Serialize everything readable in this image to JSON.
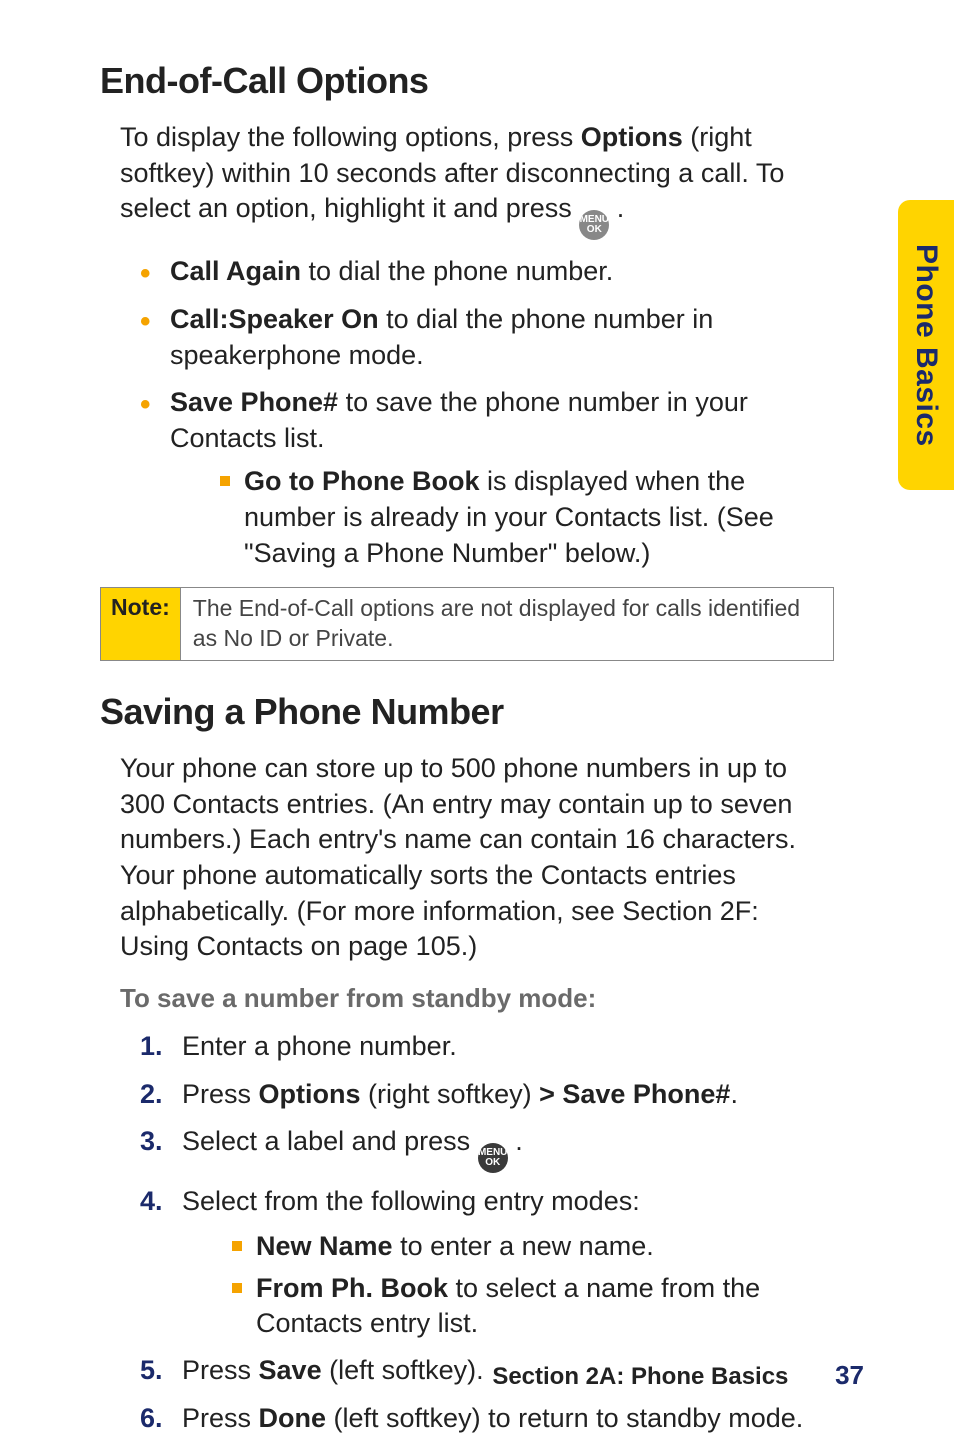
{
  "sideTab": "Phone Basics",
  "menuIconText": "MENU\nOK",
  "section1": {
    "title": "End-of-Call Options",
    "intro_part1": "To display the following options, press ",
    "intro_bold1": "Options",
    "intro_part2": " (right softkey) within 10 seconds after disconnecting a call. To select an option, highlight it and press ",
    "intro_part3": " .",
    "bullets": [
      {
        "bold": "Call Again",
        "rest": " to dial the phone number."
      },
      {
        "bold": "Call:Speaker On",
        "rest": " to dial the phone number in speakerphone mode."
      },
      {
        "bold": "Save Phone#",
        "rest": " to save the phone number in your Contacts list."
      }
    ],
    "sub": [
      {
        "bold": "Go to Phone Book",
        "rest": " is displayed when the number is already in your Contacts list. (See \"Saving a Phone Number\" below.)"
      }
    ],
    "noteLabel": "Note:",
    "noteText": "The End-of-Call options are not displayed for calls identified as No ID or Private."
  },
  "section2": {
    "title": "Saving a Phone Number",
    "intro": "Your phone can store up to 500 phone numbers in up to 300 Contacts entries. (An entry may contain up to seven numbers.) Each entry's name can contain 16 characters. Your phone automatically sorts the Contacts entries alphabetically. (For more information, see Section 2F: Using Contacts on page 105.)",
    "subhead": "To save a number from standby mode:",
    "steps": {
      "s1": "Enter a phone number.",
      "s2_a": "Press ",
      "s2_b": "Options",
      "s2_c": " (right softkey) ",
      "s2_d": "> Save Phone#",
      "s2_e": ".",
      "s3_a": "Select a label and press ",
      "s3_b": " .",
      "s4": "Select from the following entry modes:",
      "s4_sub": [
        {
          "bold": "New Name",
          "rest": " to enter a new name."
        },
        {
          "bold": "From Ph. Book",
          "rest": " to select a name from the Contacts entry list."
        }
      ],
      "s5_a": "Press ",
      "s5_b": "Save",
      "s5_c": " (left softkey).",
      "s6_a": "Press ",
      "s6_b": "Done",
      "s6_c": " (left softkey) to return to standby mode."
    }
  },
  "footer": {
    "section": "Section 2A: Phone Basics",
    "page": "37"
  }
}
